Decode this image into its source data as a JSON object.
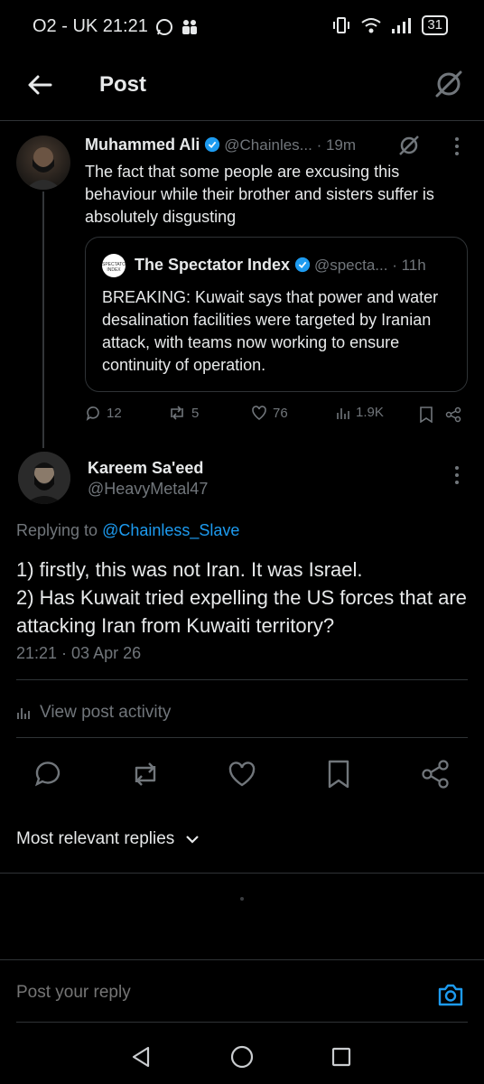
{
  "status_bar": {
    "carrier_time": "O2 - UK 21:21",
    "battery": "31"
  },
  "header": {
    "title": "Post"
  },
  "parent_post": {
    "author_name": "Muhammed Ali",
    "handle_time": "@Chainles... · 19m",
    "text": "The fact that some people are excusing this behaviour while their brother and sisters suffer is absolutely disgusting",
    "quote": {
      "author_name": "The Spectator Index",
      "handle_time": "@specta... · 11h",
      "logo_text": "SPECTATOR INDEX",
      "text": "BREAKING: Kuwait says that power and water desalination facilities were targeted by Iranian attack, with teams now working to ensure continuity of operation."
    },
    "replies": "12",
    "reposts": "5",
    "likes": "76",
    "views": "1.9K"
  },
  "main_post": {
    "author_name": "Kareem Sa'eed",
    "handle": "@HeavyMetal47",
    "replying_prefix": "Replying to",
    "replying_to": "@Chainless_Slave",
    "line1": "1) firstly, this was not Iran. It was Israel.",
    "line2": "2) Has Kuwait tried expelling the US forces that are attacking Iran from Kuwaiti territory?",
    "timestamp": "21:21 · 03 Apr 26",
    "activity": "View post activity"
  },
  "sort": {
    "label": "Most relevant replies"
  },
  "reply_input": {
    "placeholder": "Post your reply"
  },
  "colors": {
    "accent": "#1d9bf0",
    "background": "#000000",
    "text": "#e7e9ea",
    "muted": "#71767b"
  }
}
